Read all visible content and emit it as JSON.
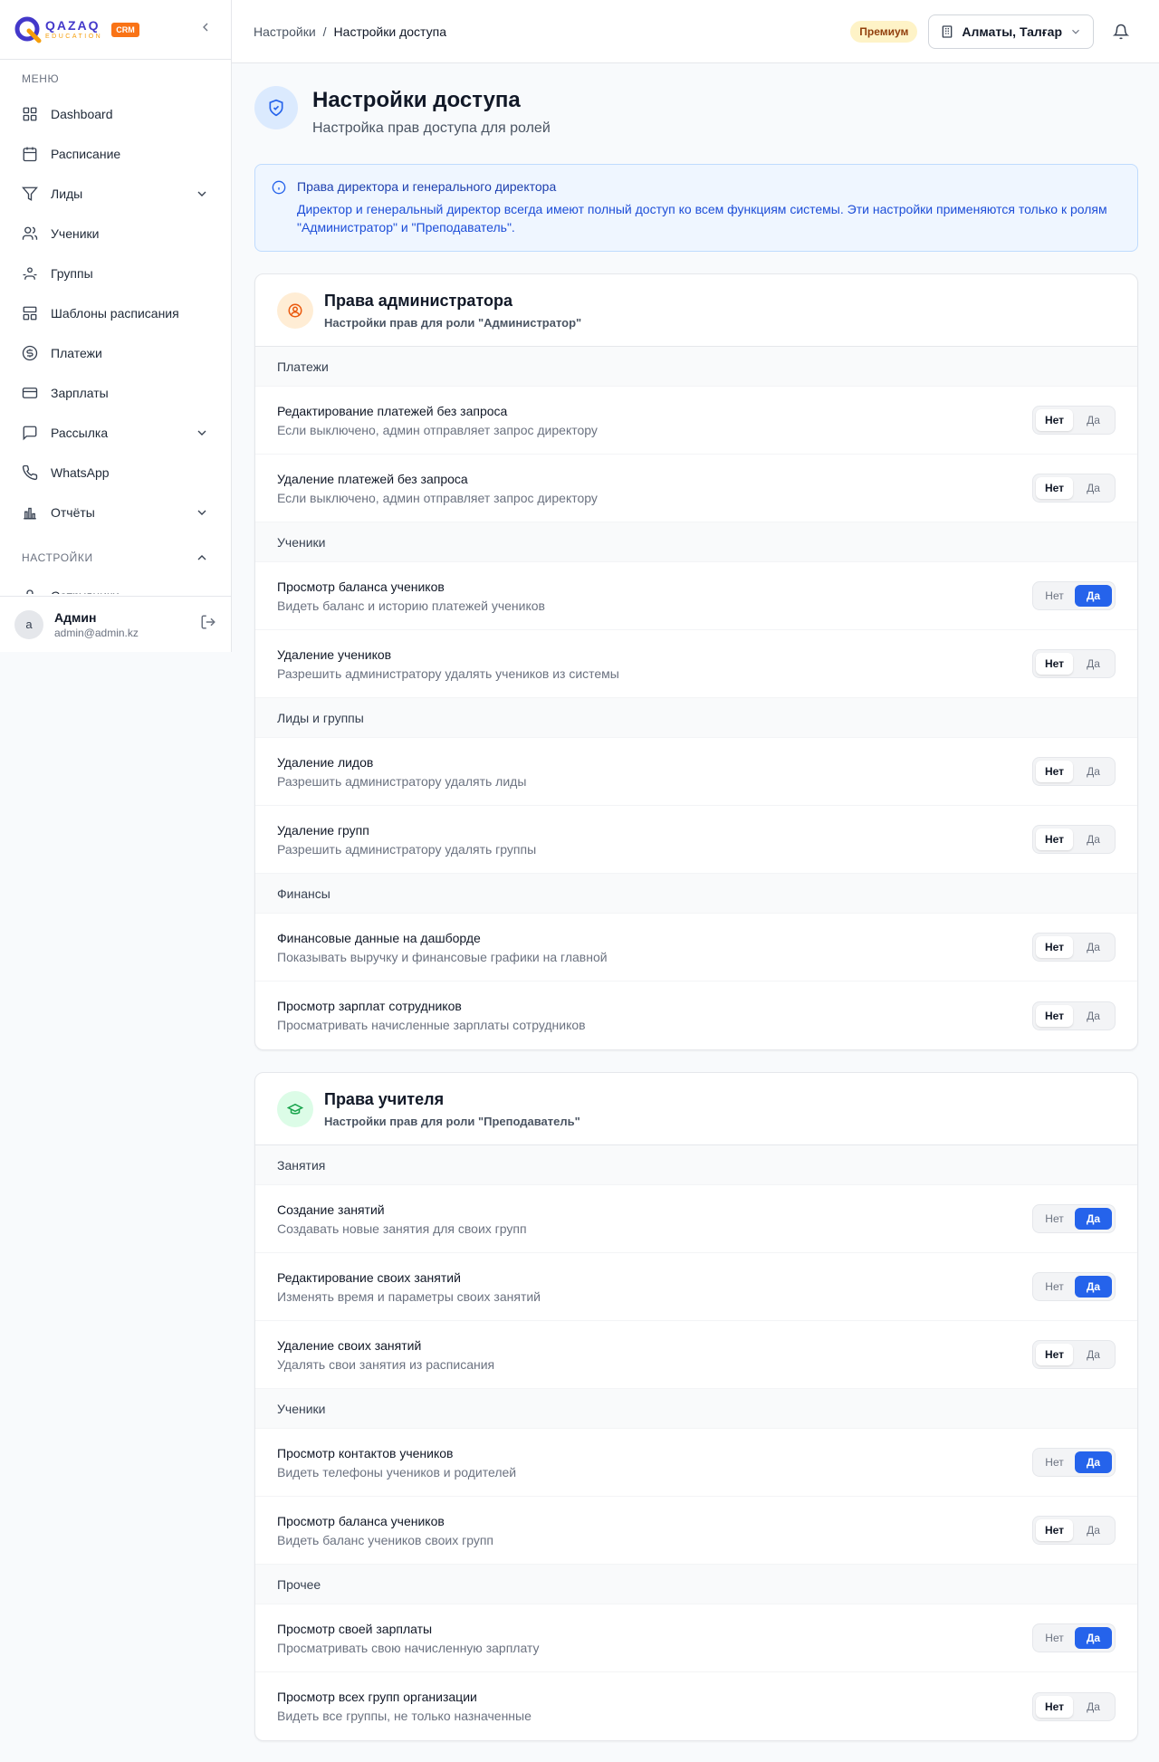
{
  "app": {
    "brand": "QAZAQ",
    "brand_sub": "EDUCATION",
    "badge": "CRM"
  },
  "sidebar": {
    "menu_label": "МЕНЮ",
    "items": [
      {
        "label": "Dashboard",
        "icon": "grid-icon"
      },
      {
        "label": "Расписание",
        "icon": "calendar-icon"
      },
      {
        "label": "Лиды",
        "icon": "filter-icon",
        "expandable": true
      },
      {
        "label": "Ученики",
        "icon": "users-icon"
      },
      {
        "label": "Группы",
        "icon": "groups-icon"
      },
      {
        "label": "Шаблоны расписания",
        "icon": "template-icon"
      },
      {
        "label": "Платежи",
        "icon": "dollar-icon"
      },
      {
        "label": "Зарплаты",
        "icon": "wallet-icon"
      },
      {
        "label": "Рассылка",
        "icon": "message-icon",
        "expandable": true
      },
      {
        "label": "WhatsApp",
        "icon": "phone-icon"
      },
      {
        "label": "Отчёты",
        "icon": "bar-chart-icon",
        "expandable": true
      }
    ],
    "settings_label": "НАСТРОЙКИ",
    "settings_items": [
      {
        "label": "Сотрудники",
        "icon": "user-icon"
      }
    ],
    "user": {
      "initial": "a",
      "name": "Админ",
      "email": "admin@admin.kz"
    }
  },
  "topbar": {
    "breadcrumb": [
      "Настройки",
      "Настройки доступа"
    ],
    "separator": "/",
    "premium": "Премиум",
    "branch": "Алматы, Талғар"
  },
  "page": {
    "title": "Настройки доступа",
    "subtitle": "Настройка прав доступа для ролей"
  },
  "info": {
    "title": "Права директора и генерального директора",
    "text": "Директор и генеральный директор всегда имеют полный доступ ко всем функциям системы. Эти настройки применяются только к ролям \"Администратор\" и \"Преподаватель\"."
  },
  "toggle_labels": {
    "no": "Нет",
    "yes": "Да"
  },
  "cards": [
    {
      "title": "Права администратора",
      "subtitle": "Настройки прав для роли \"Администратор\"",
      "groups": [
        {
          "label": "Платежи",
          "rows": [
            {
              "title": "Редактирование платежей без запроса",
              "desc": "Если выключено, админ отправляет запрос директору",
              "value": false
            },
            {
              "title": "Удаление платежей без запроса",
              "desc": "Если выключено, админ отправляет запрос директору",
              "value": false
            }
          ]
        },
        {
          "label": "Ученики",
          "rows": [
            {
              "title": "Просмотр баланса учеников",
              "desc": "Видеть баланс и историю платежей учеников",
              "value": true
            },
            {
              "title": "Удаление учеников",
              "desc": "Разрешить администратору удалять учеников из системы",
              "value": false
            }
          ]
        },
        {
          "label": "Лиды и группы",
          "rows": [
            {
              "title": "Удаление лидов",
              "desc": "Разрешить администратору удалять лиды",
              "value": false
            },
            {
              "title": "Удаление групп",
              "desc": "Разрешить администратору удалять группы",
              "value": false
            }
          ]
        },
        {
          "label": "Финансы",
          "rows": [
            {
              "title": "Финансовые данные на дашборде",
              "desc": "Показывать выручку и финансовые графики на главной",
              "value": false
            },
            {
              "title": "Просмотр зарплат сотрудников",
              "desc": "Просматривать начисленные зарплаты сотрудников",
              "value": false
            }
          ]
        }
      ]
    },
    {
      "title": "Права учителя",
      "subtitle": "Настройки прав для роли \"Преподаватель\"",
      "groups": [
        {
          "label": "Занятия",
          "rows": [
            {
              "title": "Создание занятий",
              "desc": "Создавать новые занятия для своих групп",
              "value": true
            },
            {
              "title": "Редактирование своих занятий",
              "desc": "Изменять время и параметры своих занятий",
              "value": true
            },
            {
              "title": "Удаление своих занятий",
              "desc": "Удалять свои занятия из расписания",
              "value": false
            }
          ]
        },
        {
          "label": "Ученики",
          "rows": [
            {
              "title": "Просмотр контактов учеников",
              "desc": "Видеть телефоны учеников и родителей",
              "value": true
            },
            {
              "title": "Просмотр баланса учеников",
              "desc": "Видеть баланс учеников своих групп",
              "value": false
            }
          ]
        },
        {
          "label": "Прочее",
          "rows": [
            {
              "title": "Просмотр своей зарплаты",
              "desc": "Просматривать свою начисленную зарплату",
              "value": true
            },
            {
              "title": "Просмотр всех групп организации",
              "desc": "Видеть все группы, не только назначенные",
              "value": false
            }
          ]
        }
      ]
    }
  ]
}
